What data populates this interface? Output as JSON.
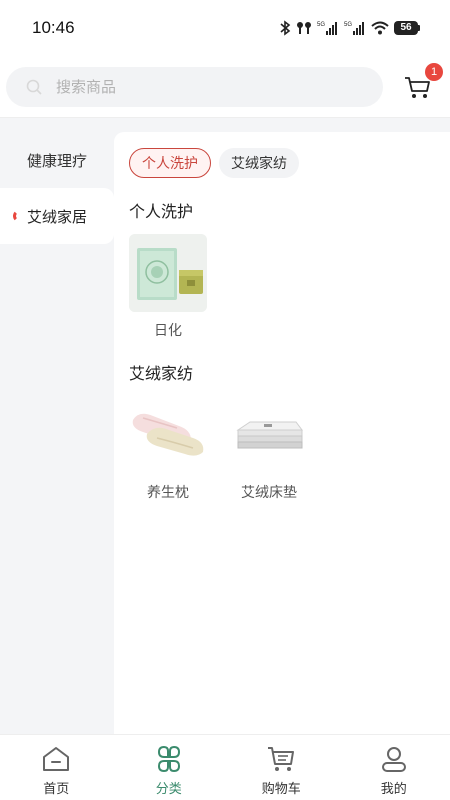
{
  "status_bar": {
    "time": "10:46",
    "battery": "56"
  },
  "search": {
    "placeholder": "搜索商品"
  },
  "cart": {
    "badge_count": "1"
  },
  "sidebar": {
    "items": [
      {
        "label": "健康理疗",
        "active": false
      },
      {
        "label": "艾绒家居",
        "active": true
      }
    ]
  },
  "chips": [
    {
      "label": "个人洗护",
      "active": true
    },
    {
      "label": "艾绒家纺",
      "active": false
    }
  ],
  "sections": [
    {
      "title": "个人洗护",
      "products": [
        {
          "label": "日化",
          "icon": "soap-product-image"
        }
      ]
    },
    {
      "title": "艾绒家纺",
      "products": [
        {
          "label": "养生枕",
          "icon": "pillow-product-image"
        },
        {
          "label": "艾绒床垫",
          "icon": "mattress-product-image"
        }
      ]
    }
  ],
  "tabbar": {
    "tabs": [
      {
        "label": "首页",
        "icon": "home-icon",
        "active": false
      },
      {
        "label": "分类",
        "icon": "category-icon",
        "active": true
      },
      {
        "label": "购物车",
        "icon": "cart-icon",
        "active": false
      },
      {
        "label": "我的",
        "icon": "profile-icon",
        "active": false
      }
    ]
  },
  "colors": {
    "accent_red": "#c9463d",
    "badge_red": "#e8473e",
    "active_green": "#3b8b6d"
  }
}
